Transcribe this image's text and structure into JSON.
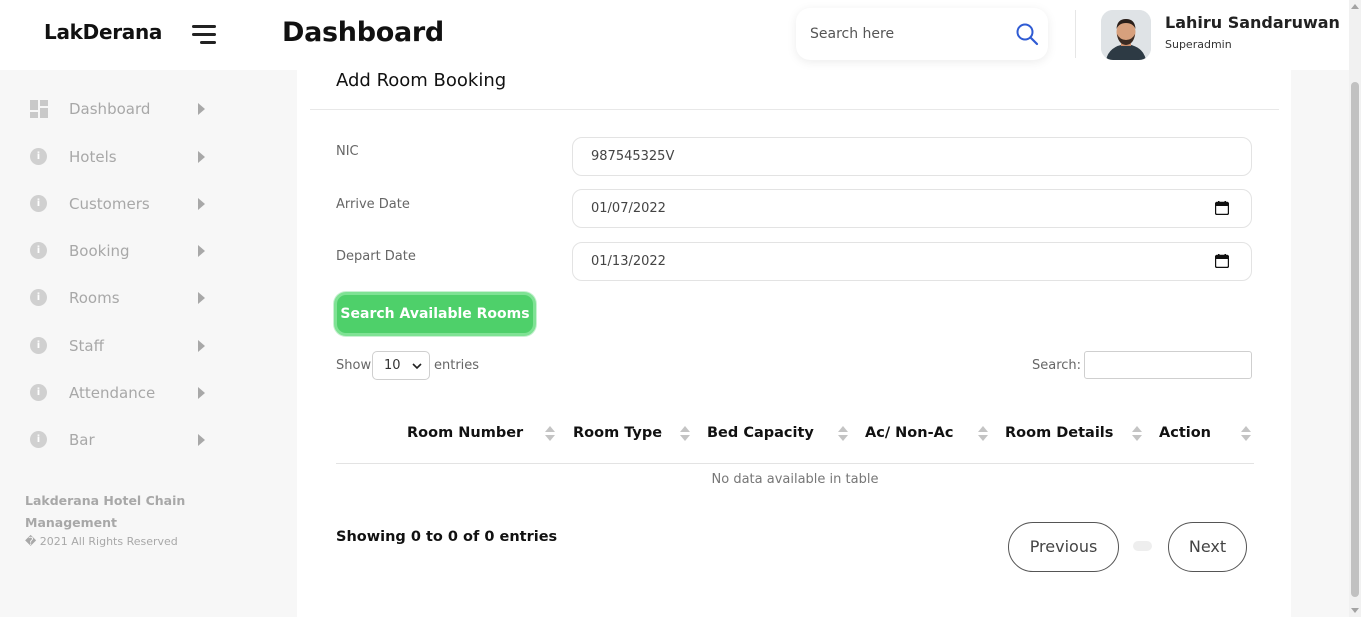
{
  "app": {
    "brand": "LakDerana",
    "page_title": "Dashboard"
  },
  "header": {
    "search_placeholder": "Search here",
    "user_name": "Lahiru Sandaruwan",
    "user_role": "Superadmin"
  },
  "sidebar": {
    "items": [
      {
        "label": "Dashboard",
        "icon": "dashboard-grid-icon"
      },
      {
        "label": "Hotels",
        "icon": "info-icon"
      },
      {
        "label": "Customers",
        "icon": "info-icon"
      },
      {
        "label": "Booking",
        "icon": "info-icon"
      },
      {
        "label": "Rooms",
        "icon": "info-icon"
      },
      {
        "label": "Staff",
        "icon": "info-icon"
      },
      {
        "label": "Attendance",
        "icon": "info-icon"
      },
      {
        "label": "Bar",
        "icon": "info-icon"
      }
    ],
    "footer_title": "Lakderana Hotel Chain Management",
    "footer_copy": "� 2021 All Rights Reserved"
  },
  "form": {
    "title": "Add Room Booking",
    "nic_label": "NIC",
    "nic_value": "987545325V",
    "arrive_label": "Arrive Date",
    "arrive_value": "01/07/2022",
    "depart_label": "Depart Date",
    "depart_value": "01/13/2022",
    "search_button": "Search Available Rooms"
  },
  "table": {
    "show_label": "Show",
    "entries_label": "entries",
    "page_length": "10",
    "search_label": "Search:",
    "columns": [
      "Room Number",
      "Room Type",
      "Bed Capacity",
      "Ac/ Non-Ac",
      "Room Details",
      "Action"
    ],
    "empty_message": "No data available in table",
    "info": "Showing 0 to 0 of 0 entries",
    "prev_label": "Previous",
    "next_label": "Next"
  },
  "colors": {
    "accent_green": "#4ed06a",
    "search_icon_blue": "#2f5bd3",
    "muted_gray": "#a8a8a8"
  }
}
